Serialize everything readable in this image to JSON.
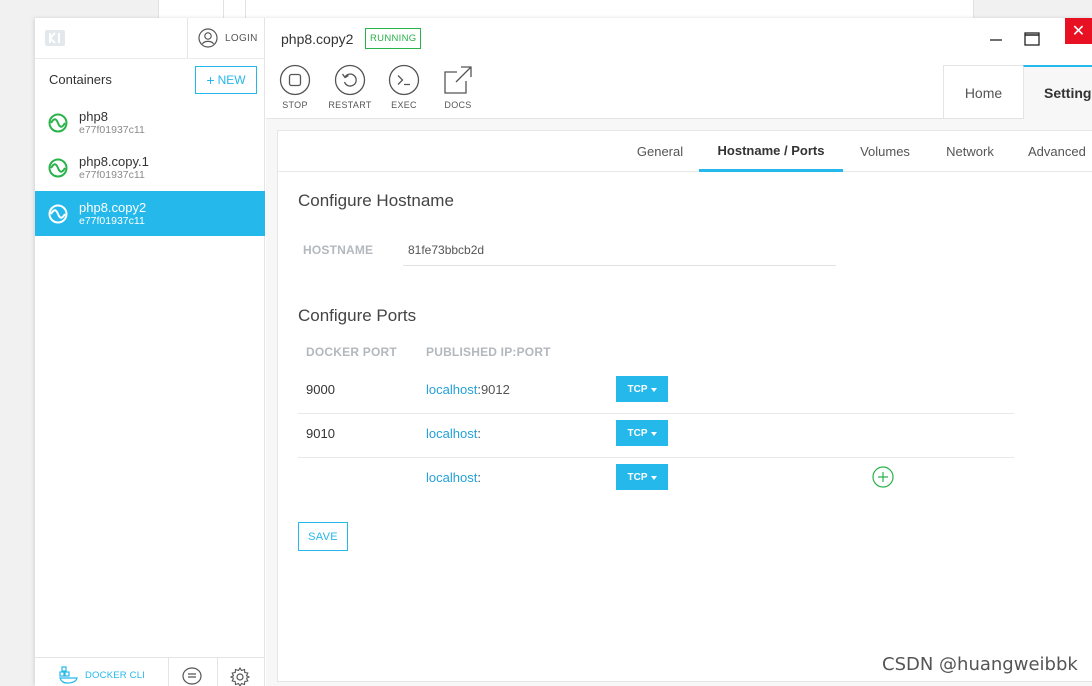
{
  "sidebar": {
    "login_label": "LOGIN",
    "containers_title": "Containers",
    "new_button": "NEW",
    "containers": [
      {
        "name": "php8",
        "id": "e77f01937c11",
        "selected": false
      },
      {
        "name": "php8.copy.1",
        "id": "e77f01937c11",
        "selected": false
      },
      {
        "name": "php8.copy2",
        "id": "e77f01937c11",
        "selected": true
      }
    ],
    "docker_cli_label": "DOCKER CLI"
  },
  "header": {
    "container_name": "php8.copy2",
    "status_badge": "RUNNING",
    "toolbar": {
      "stop": "STOP",
      "restart": "RESTART",
      "exec": "EXEC",
      "docs": "DOCS"
    },
    "close_symbol": "✕",
    "tabs": {
      "home": "Home",
      "settings": "Settings"
    }
  },
  "settings": {
    "subtabs": [
      "General",
      "Hostname / Ports",
      "Volumes",
      "Network",
      "Advanced"
    ],
    "active_subtab": "Hostname / Ports",
    "hostname_section": {
      "title": "Configure Hostname",
      "label": "HOSTNAME",
      "value": "81fe73bbcb2d"
    },
    "ports_section": {
      "title": "Configure Ports",
      "col_docker_port": "DOCKER PORT",
      "col_published": "PUBLISHED IP:PORT",
      "rows": [
        {
          "docker_port": "9000",
          "host": "localhost",
          "sep": ":",
          "port": "9012",
          "protocol": "TCP"
        },
        {
          "docker_port": "9010",
          "host": "localhost",
          "sep": ":",
          "port": "",
          "protocol": "TCP"
        },
        {
          "docker_port": "",
          "host": "localhost",
          "sep": ":",
          "port": "",
          "protocol": "TCP"
        }
      ]
    },
    "save_button": "SAVE"
  },
  "watermark": "CSDN @huangweibbk",
  "colors": {
    "accent": "#24b8eb",
    "running_green": "#29b34a",
    "close_red": "#e81123"
  }
}
